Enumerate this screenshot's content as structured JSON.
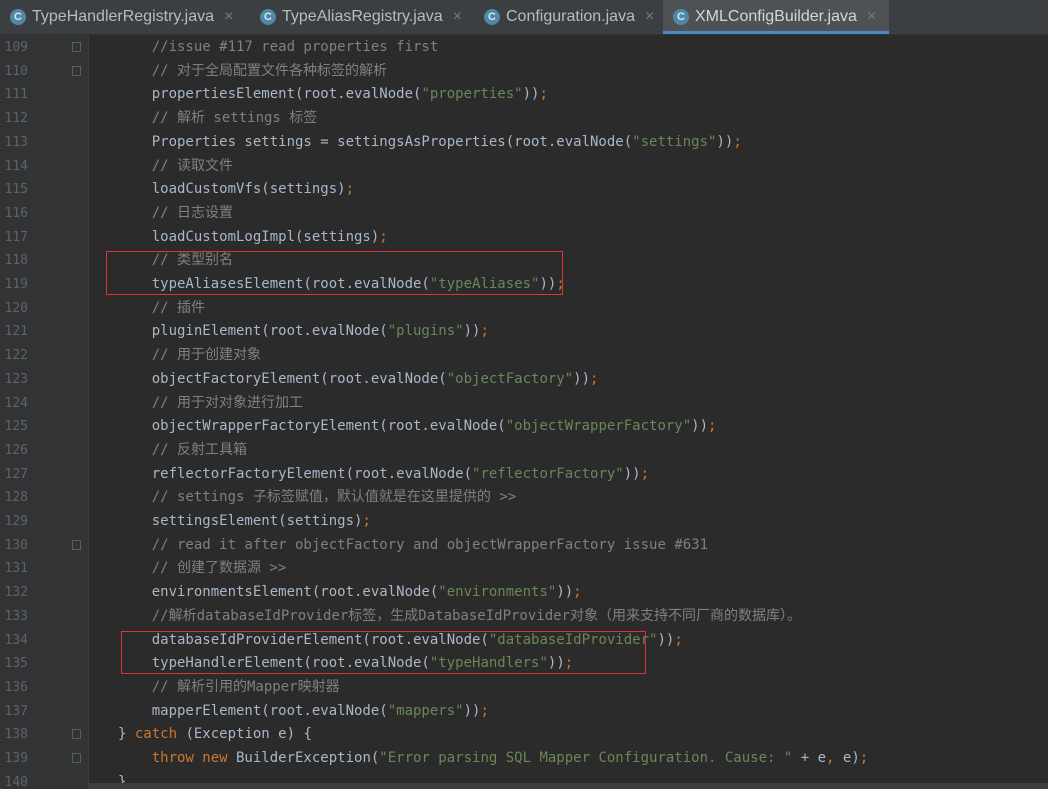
{
  "tabs": [
    {
      "icon": "C",
      "label": "TypeHandlerRegistry.java",
      "close": "×",
      "active": false
    },
    {
      "icon": "C",
      "label": "TypeAliasRegistry.java",
      "close": "×",
      "active": false
    },
    {
      "icon": "C",
      "label": "Configuration.java",
      "close": "×",
      "active": false
    },
    {
      "icon": "C",
      "label": "XMLConfigBuilder.java",
      "close": "×",
      "active": true
    }
  ],
  "lines": [
    {
      "n": "109",
      "segs": [
        {
          "t": "    //issue #117 read properties first",
          "c": "c"
        }
      ]
    },
    {
      "n": "110",
      "segs": [
        {
          "t": "    // 对于全局配置文件各种标签的解析",
          "c": "c"
        }
      ]
    },
    {
      "n": "111",
      "segs": [
        {
          "t": "    propertiesElement(root.evalNode(",
          "c": ""
        },
        {
          "t": "\"properties\"",
          "c": "s"
        },
        {
          "t": "))",
          "c": ""
        },
        {
          "t": ";",
          "c": "p"
        }
      ]
    },
    {
      "n": "112",
      "segs": [
        {
          "t": "    // 解析 settings 标签",
          "c": "c"
        }
      ]
    },
    {
      "n": "113",
      "segs": [
        {
          "t": "    Properties settings = settingsAsProperties(root.evalNode(",
          "c": ""
        },
        {
          "t": "\"settings\"",
          "c": "s"
        },
        {
          "t": "))",
          "c": ""
        },
        {
          "t": ";",
          "c": "p"
        }
      ]
    },
    {
      "n": "114",
      "segs": [
        {
          "t": "    // 读取文件",
          "c": "c"
        }
      ]
    },
    {
      "n": "115",
      "segs": [
        {
          "t": "    loadCustomVfs(settings)",
          "c": ""
        },
        {
          "t": ";",
          "c": "p"
        }
      ]
    },
    {
      "n": "116",
      "segs": [
        {
          "t": "    // 日志设置",
          "c": "c"
        }
      ]
    },
    {
      "n": "117",
      "segs": [
        {
          "t": "    loadCustomLogImpl(settings)",
          "c": ""
        },
        {
          "t": ";",
          "c": "p"
        }
      ]
    },
    {
      "n": "118",
      "segs": [
        {
          "t": "    // 类型别名",
          "c": "c"
        }
      ]
    },
    {
      "n": "119",
      "segs": [
        {
          "t": "    typeAliasesElement(root.evalNode(",
          "c": ""
        },
        {
          "t": "\"typeAliases\"",
          "c": "s"
        },
        {
          "t": "))",
          "c": ""
        },
        {
          "t": ";",
          "c": "p"
        }
      ]
    },
    {
      "n": "120",
      "segs": [
        {
          "t": "    // 插件",
          "c": "c"
        }
      ]
    },
    {
      "n": "121",
      "segs": [
        {
          "t": "    pluginElement(root.evalNode(",
          "c": ""
        },
        {
          "t": "\"plugins\"",
          "c": "s"
        },
        {
          "t": "))",
          "c": ""
        },
        {
          "t": ";",
          "c": "p"
        }
      ]
    },
    {
      "n": "122",
      "segs": [
        {
          "t": "    // 用于创建对象",
          "c": "c"
        }
      ]
    },
    {
      "n": "123",
      "segs": [
        {
          "t": "    objectFactoryElement(root.evalNode(",
          "c": ""
        },
        {
          "t": "\"objectFactory\"",
          "c": "s"
        },
        {
          "t": "))",
          "c": ""
        },
        {
          "t": ";",
          "c": "p"
        }
      ]
    },
    {
      "n": "124",
      "segs": [
        {
          "t": "    // 用于对对象进行加工",
          "c": "c"
        }
      ]
    },
    {
      "n": "125",
      "segs": [
        {
          "t": "    objectWrapperFactoryElement(root.evalNode(",
          "c": ""
        },
        {
          "t": "\"objectWrapperFactory\"",
          "c": "s"
        },
        {
          "t": "))",
          "c": ""
        },
        {
          "t": ";",
          "c": "p"
        }
      ]
    },
    {
      "n": "126",
      "segs": [
        {
          "t": "    // 反射工具箱",
          "c": "c"
        }
      ]
    },
    {
      "n": "127",
      "segs": [
        {
          "t": "    reflectorFactoryElement(root.evalNode(",
          "c": ""
        },
        {
          "t": "\"reflectorFactory\"",
          "c": "s"
        },
        {
          "t": "))",
          "c": ""
        },
        {
          "t": ";",
          "c": "p"
        }
      ]
    },
    {
      "n": "128",
      "segs": [
        {
          "t": "    // settings 子标签赋值，默认值就是在这里提供的 >>",
          "c": "c"
        }
      ]
    },
    {
      "n": "129",
      "segs": [
        {
          "t": "    settingsElement(settings)",
          "c": ""
        },
        {
          "t": ";",
          "c": "p"
        }
      ]
    },
    {
      "n": "130",
      "segs": [
        {
          "t": "    // read it after objectFactory and objectWrapperFactory issue #631",
          "c": "c"
        }
      ]
    },
    {
      "n": "131",
      "segs": [
        {
          "t": "    // 创建了数据源 >>",
          "c": "c"
        }
      ]
    },
    {
      "n": "132",
      "segs": [
        {
          "t": "    environmentsElement(root.evalNode(",
          "c": ""
        },
        {
          "t": "\"environments\"",
          "c": "s"
        },
        {
          "t": "))",
          "c": ""
        },
        {
          "t": ";",
          "c": "p"
        }
      ]
    },
    {
      "n": "133",
      "segs": [
        {
          "t": "    //解析databaseIdProvider标签，生成DatabaseIdProvider对象（用来支持不同厂商的数据库）。",
          "c": "c"
        }
      ]
    },
    {
      "n": "134",
      "segs": [
        {
          "t": "    databaseIdProviderElement(root.evalNode(",
          "c": ""
        },
        {
          "t": "\"databaseIdProvider\"",
          "c": "s"
        },
        {
          "t": "))",
          "c": ""
        },
        {
          "t": ";",
          "c": "p"
        }
      ]
    },
    {
      "n": "135",
      "segs": [
        {
          "t": "    typeHandlerElement(root.evalNode(",
          "c": ""
        },
        {
          "t": "\"typeHandlers\"",
          "c": "s"
        },
        {
          "t": "))",
          "c": ""
        },
        {
          "t": ";",
          "c": "p"
        }
      ]
    },
    {
      "n": "136",
      "segs": [
        {
          "t": "    // 解析引用的Mapper映射器",
          "c": "c"
        }
      ]
    },
    {
      "n": "137",
      "segs": [
        {
          "t": "    mapperElement(root.evalNode(",
          "c": ""
        },
        {
          "t": "\"mappers\"",
          "c": "s"
        },
        {
          "t": "))",
          "c": ""
        },
        {
          "t": ";",
          "c": "p"
        }
      ]
    },
    {
      "n": "138",
      "segs": [
        {
          "t": "} ",
          "c": ""
        },
        {
          "t": "catch",
          "c": "k"
        },
        {
          "t": " (Exception e) {",
          "c": ""
        }
      ]
    },
    {
      "n": "139",
      "segs": [
        {
          "t": "    ",
          "c": ""
        },
        {
          "t": "throw new",
          "c": "k"
        },
        {
          "t": " BuilderException(",
          "c": ""
        },
        {
          "t": "\"Error parsing SQL Mapper Configuration. Cause: \"",
          "c": "s"
        },
        {
          "t": " + e",
          "c": ""
        },
        {
          "t": ",",
          "c": "p"
        },
        {
          "t": " e)",
          "c": ""
        },
        {
          "t": ";",
          "c": "p"
        }
      ]
    },
    {
      "n": "140",
      "segs": [
        {
          "t": "}",
          "c": ""
        }
      ]
    }
  ],
  "fold_markers": [
    "109",
    "110",
    "130",
    "138",
    "139"
  ],
  "highlights": [
    "119",
    "135"
  ],
  "colors": {
    "background": "#2b2b2b",
    "keyword": "#cc7832",
    "string": "#6a8759",
    "comment": "#808080",
    "text": "#a9b7c6",
    "highlight_box": "#e03232",
    "tab_accent": "#4a88c7"
  }
}
